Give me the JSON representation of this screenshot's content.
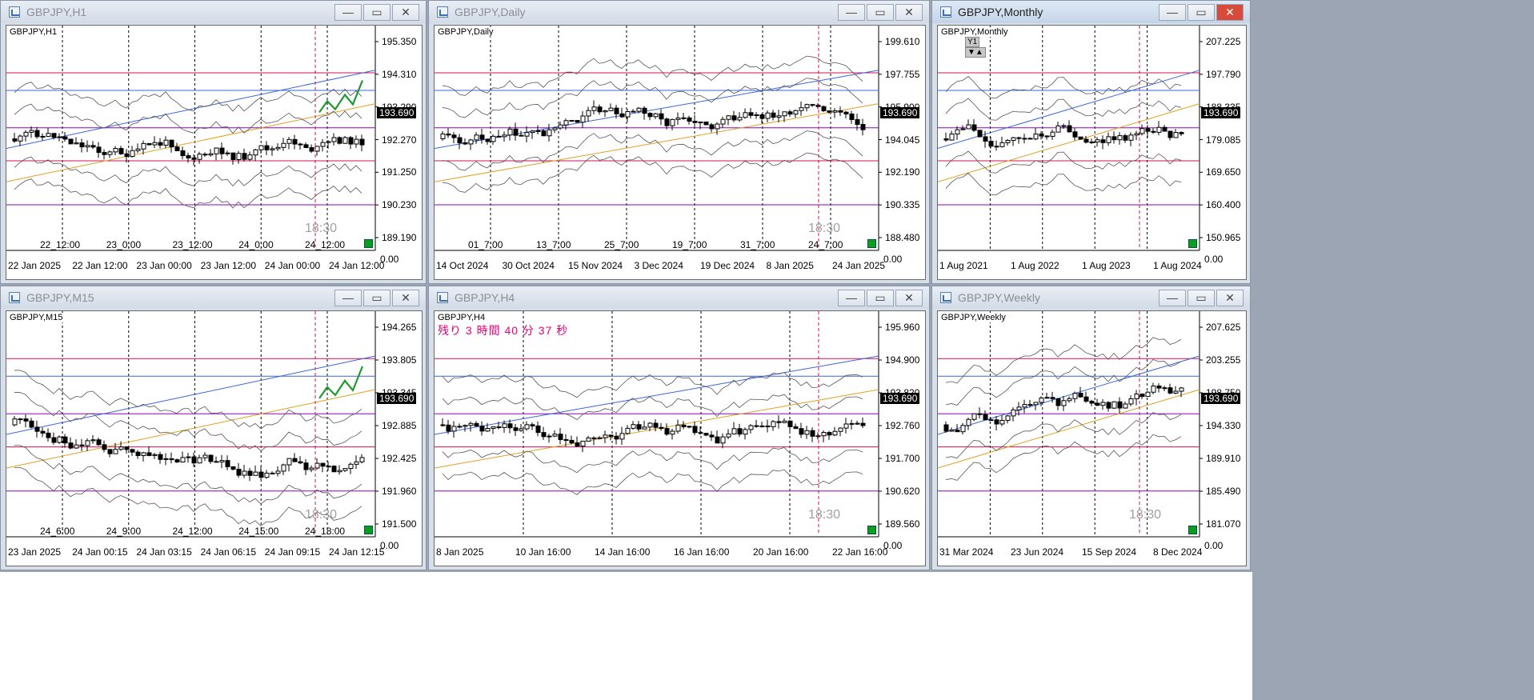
{
  "colors": {
    "magenta": "#d0105a",
    "blue": "#3a66d8",
    "purple": "#9000c0",
    "orange": "#e0a020",
    "olive": "#8a9a2a",
    "green": "#1e9a30",
    "band": "#555555",
    "candle": "#000000"
  },
  "windows": [
    {
      "id": "h1",
      "title": "GBPJPY,H1",
      "active": false,
      "label": "GBPJPY,H1",
      "prices": [
        "195.350",
        "194.310",
        "193.290",
        "192.270",
        "191.250",
        "190.230",
        "189.190"
      ],
      "current_price": "193.690",
      "times": [
        "22 Jan 2025",
        "22 Jan 12:00",
        "23 Jan 00:00",
        "23 Jan 12:00",
        "24 Jan 00:00",
        "24 Jan 12:00"
      ],
      "period_labels": [
        "22_12:00",
        "23_0:00",
        "23_12:00",
        "24_0:00",
        "24_12:00"
      ],
      "countdown": "18:30",
      "corner": "0.00"
    },
    {
      "id": "daily",
      "title": "GBPJPY,Daily",
      "active": false,
      "label": "GBPJPY,Daily",
      "prices": [
        "199.610",
        "197.755",
        "195.900",
        "194.045",
        "192.190",
        "190.335",
        "188.480"
      ],
      "current_price": "193.690",
      "times": [
        "14 Oct 2024",
        "30 Oct 2024",
        "15 Nov 2024",
        "3 Dec 2024",
        "19 Dec 2024",
        "8 Jan 2025",
        "24 Jan 2025"
      ],
      "period_labels": [
        "01_7:00",
        "13_7:00",
        "25_7:00",
        "19_7:00",
        "31_7:00",
        "24_7:00"
      ],
      "countdown": "18:30",
      "corner": "0.00"
    },
    {
      "id": "monthly",
      "title": "GBPJPY,Monthly",
      "active": true,
      "label": "GBPJPY,Monthly",
      "prices": [
        "207.225",
        "197.790",
        "188.335",
        "179.085",
        "169.650",
        "160.400",
        "150.965"
      ],
      "current_price": "193.690",
      "times": [
        "1 Aug 2021",
        "1 Aug 2022",
        "1 Aug 2023",
        "1 Aug 2024"
      ],
      "y1_label": "Y1",
      "corner": "0.00"
    },
    {
      "id": "m15",
      "title": "GBPJPY,M15",
      "active": false,
      "label": "GBPJPY,M15",
      "prices": [
        "194.265",
        "193.805",
        "193.345",
        "192.885",
        "192.425",
        "191.960",
        "191.500"
      ],
      "current_price": "193.690",
      "times": [
        "23 Jan 2025",
        "24 Jan 00:15",
        "24 Jan 03:15",
        "24 Jan 06:15",
        "24 Jan 09:15",
        "24 Jan 12:15"
      ],
      "period_labels": [
        "24_6:00",
        "24_9:00",
        "24_12:00",
        "24_15:00",
        "24_18:00"
      ],
      "countdown": "18:30",
      "corner": "0.00"
    },
    {
      "id": "h4",
      "title": "GBPJPY,H4",
      "active": false,
      "label": "GBPJPY,H4",
      "timer_text": "残り 3 時間 40 分 37 秒",
      "prices": [
        "195.960",
        "194.900",
        "193.820",
        "192.760",
        "191.700",
        "190.620",
        "189.560"
      ],
      "current_price": "193.690",
      "times": [
        "8 Jan 2025",
        "10 Jan 16:00",
        "14 Jan 16:00",
        "16 Jan 16:00",
        "20 Jan 16:00",
        "22 Jan 16:00"
      ],
      "countdown": "18:30",
      "corner": "0.00"
    },
    {
      "id": "weekly",
      "title": "GBPJPY,Weekly",
      "active": false,
      "label": "GBPJPY,Weekly",
      "prices": [
        "207.625",
        "203.255",
        "198.750",
        "194.330",
        "189.910",
        "185.490",
        "181.070"
      ],
      "current_price": "193.690",
      "times": [
        "31 Mar 2024",
        "23 Jun 2024",
        "15 Sep 2024",
        "8 Dec 2024"
      ],
      "countdown": "18:30",
      "corner": "0.00"
    }
  ],
  "buttons": {
    "minimize": "—",
    "maximize": "▭",
    "close": "✕"
  }
}
